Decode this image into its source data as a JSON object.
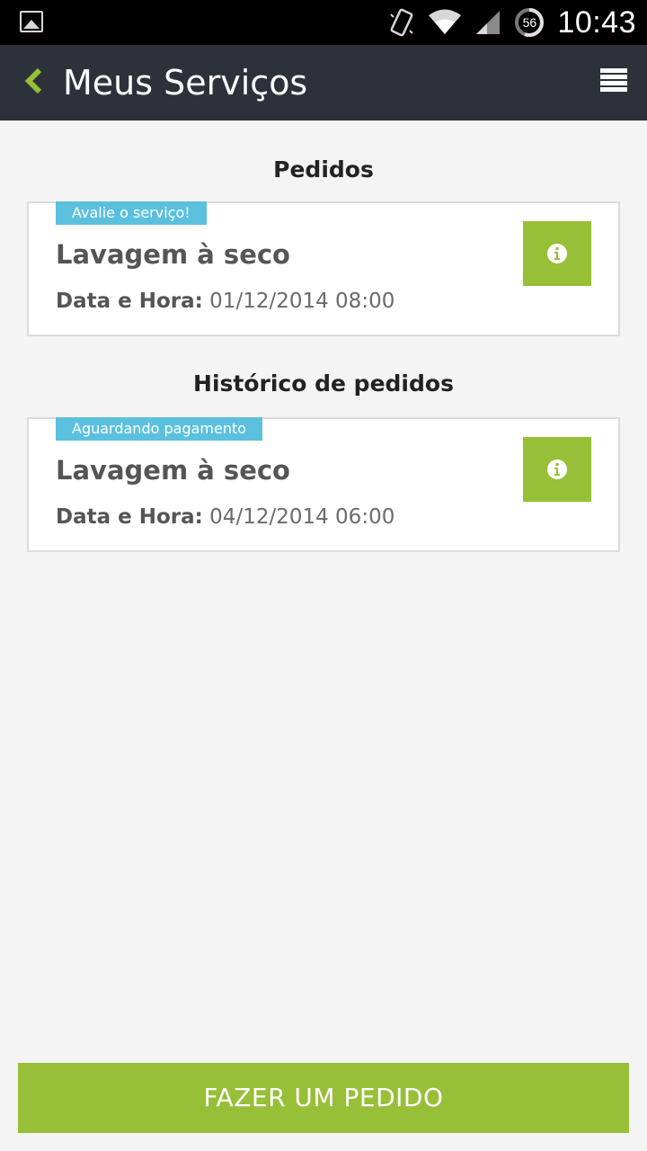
{
  "status_bar": {
    "time": "10:43",
    "battery": "56",
    "icons": [
      "gallery-icon",
      "vibrate-icon",
      "wifi-icon",
      "signal-icon",
      "battery-icon"
    ]
  },
  "app_bar": {
    "title": "Meus Serviços",
    "back_icon": "chevron-left-icon",
    "menu_icon": "menu-icon"
  },
  "sections": {
    "orders": {
      "title": "Pedidos",
      "items": [
        {
          "badge": "Avalie o serviço!",
          "name": "Lavagem à seco",
          "date_label": "Data e Hora:",
          "date_value": "01/12/2014 08:00"
        }
      ]
    },
    "history": {
      "title": "Histórico de pedidos",
      "items": [
        {
          "badge": "Aguardando pagamento",
          "name": "Lavagem à seco",
          "date_label": "Data e Hora:",
          "date_value": "04/12/2014 06:00"
        }
      ]
    }
  },
  "footer": {
    "order_button": "FAZER UM PEDIDO"
  },
  "colors": {
    "app_bar": "#2d3139",
    "accent": "#97bf37",
    "badge": "#5bc0de",
    "background": "#f4f4f4"
  }
}
